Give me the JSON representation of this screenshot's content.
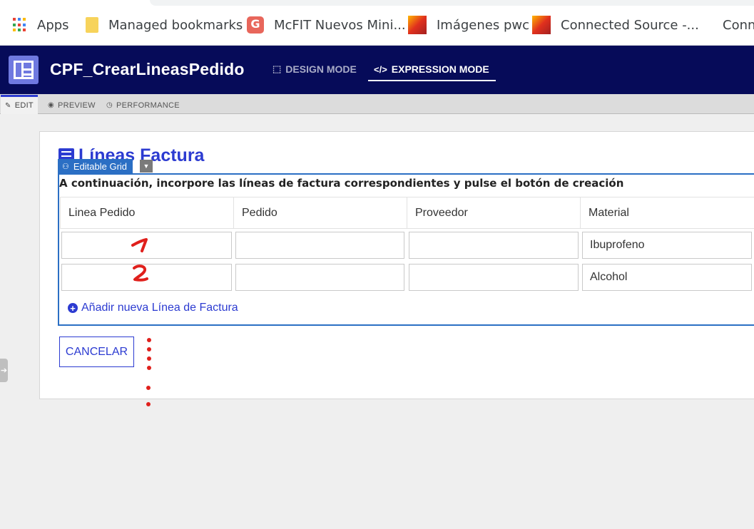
{
  "bookmarks": [
    {
      "label": "Apps",
      "icon": "apps-grid-icon"
    },
    {
      "label": "Managed bookmarks",
      "icon": "folder-icon"
    },
    {
      "label": "McFIT Nuevos Mini...",
      "icon": "g-favicon-icon"
    },
    {
      "label": "Imágenes pwc",
      "icon": "pwc-favicon-icon"
    },
    {
      "label": "Connected Source -...",
      "icon": "pwc-favicon-icon"
    },
    {
      "label": "Conne",
      "icon": ""
    }
  ],
  "header": {
    "title": "CPF_CrearLineasPedido",
    "design_mode": "DESIGN MODE",
    "expression_mode": "EXPRESSION MODE",
    "active_mode": "EXPRESSION MODE"
  },
  "subtabs": [
    {
      "label": "EDIT",
      "icon": "edit-icon",
      "active": true
    },
    {
      "label": "PREVIEW",
      "icon": "eye-icon",
      "active": false
    },
    {
      "label": "PERFORMANCE",
      "icon": "clock-icon",
      "active": false
    }
  ],
  "form": {
    "section_title": "Líneas Factura",
    "component_tag": "Editable Grid",
    "instructions": "A continuación, incorpore las líneas de factura correspondientes y pulse el botón de creación",
    "columns": [
      "Linea Pedido",
      "Pedido",
      "Proveedor",
      "Material"
    ],
    "rows": [
      [
        "",
        "",
        "",
        "Ibuprofeno"
      ],
      [
        "",
        "",
        "",
        "Alcohol"
      ]
    ],
    "add_row_label": "Añadir nueva Línea de Factura",
    "cancel_label": "CANCELAR"
  },
  "colors": {
    "header_bg": "#060b59",
    "accent": "#2c3bd1",
    "grid_border": "#2b6fc4",
    "annotation": "#e0201c"
  }
}
